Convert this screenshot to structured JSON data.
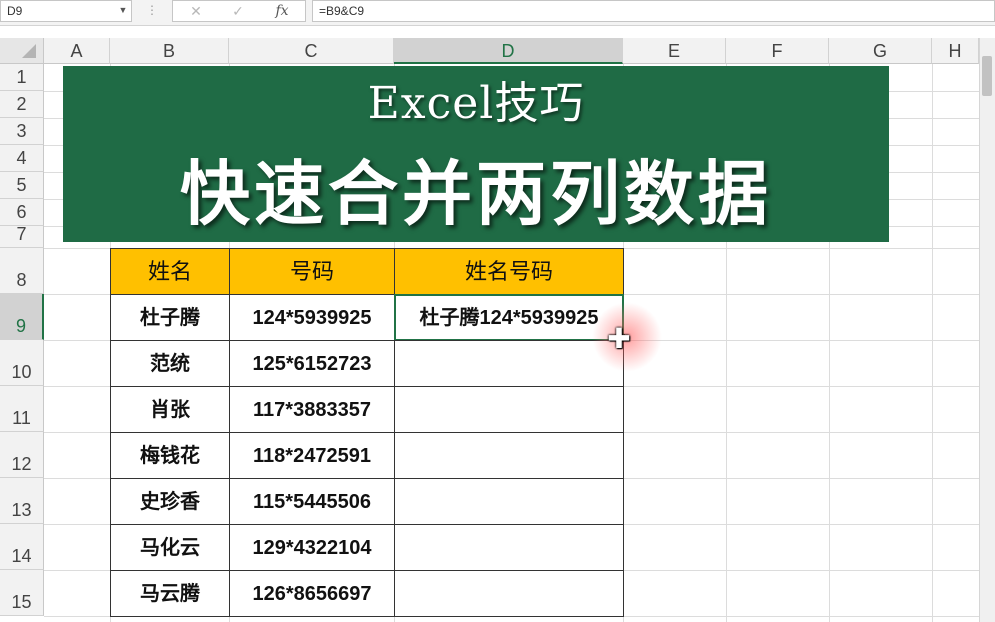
{
  "formula_bar": {
    "name_box": "D9",
    "cancel_icon": "✕",
    "enter_icon": "✓",
    "fx_label": "fx",
    "formula": "=B9&C9"
  },
  "columns": [
    "A",
    "B",
    "C",
    "D",
    "E",
    "F",
    "G",
    "H"
  ],
  "rows": [
    "1",
    "2",
    "3",
    "4",
    "5",
    "6",
    "7",
    "8",
    "9",
    "10",
    "11",
    "12",
    "13",
    "14",
    "15"
  ],
  "banner": {
    "subtitle": "Excel技巧",
    "title": "快速合并两列数据"
  },
  "table": {
    "headers": [
      "姓名",
      "号码",
      "姓名号码"
    ],
    "rows": [
      {
        "name": "杜子腾",
        "number": "124*5939925",
        "combined": "杜子腾124*5939925"
      },
      {
        "name": "范统",
        "number": "125*6152723",
        "combined": ""
      },
      {
        "name": "肖张",
        "number": "117*3883357",
        "combined": ""
      },
      {
        "name": "梅钱花",
        "number": "118*2472591",
        "combined": ""
      },
      {
        "name": "史珍香",
        "number": "115*5445506",
        "combined": ""
      },
      {
        "name": "马化云",
        "number": "129*4322104",
        "combined": ""
      },
      {
        "name": "马云腾",
        "number": "126*8656697",
        "combined": ""
      }
    ]
  },
  "colors": {
    "banner_bg": "#1f6b45",
    "header_fill": "#ffc000",
    "selection": "#217346"
  },
  "icons": {
    "cursor": "fill-cross-cursor-icon"
  }
}
